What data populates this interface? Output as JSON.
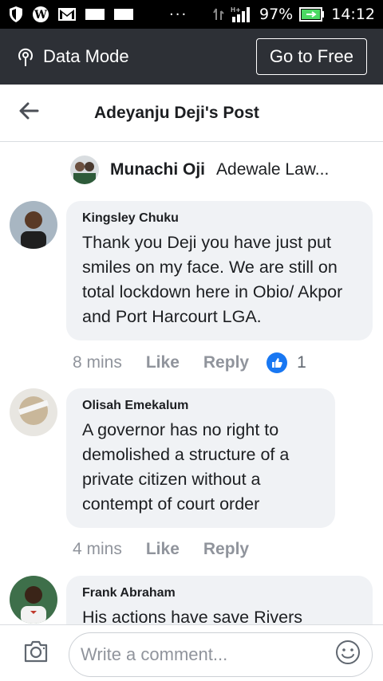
{
  "status_bar": {
    "battery": "97%",
    "time": "14:12",
    "dots": "···",
    "icons": [
      "shield-icon",
      "wordpress-icon",
      "gmail-icon",
      "message-icon",
      "message-icon",
      "vibrate-icon",
      "signal-icon",
      "battery-icon"
    ]
  },
  "data_bar": {
    "label": "Data Mode",
    "button": "Go to Free",
    "icon": "broadcast-icon"
  },
  "header": {
    "title": "Adeyanju Deji's Post",
    "back_icon": "arrow-left-icon"
  },
  "reply_preview": {
    "name": "Munachi Oji",
    "text": "Adewale Law..."
  },
  "comments": [
    {
      "name": "Kingsley Chuku",
      "text": "Thank you Deji you have just put smiles on my face. We are still on total lockdown here in Obio/ Akpor and Port Harcourt LGA.",
      "time": "8 mins",
      "like": "Like",
      "reply": "Reply",
      "reactions": "1"
    },
    {
      "name": "Olisah Emekalum",
      "text": "A governor has no right to demolished a structure of a private citizen without a contempt of court order",
      "time": "4 mins",
      "like": "Like",
      "reply": "Reply"
    },
    {
      "name": "Frank Abraham",
      "text": "His actions have save Rivers"
    }
  ],
  "composer": {
    "placeholder": "Write a comment...",
    "camera_icon": "camera-icon",
    "emoji_icon": "smiley-icon"
  },
  "colors": {
    "accent": "#1877f2",
    "dark_bar": "#2d3036",
    "bubble": "#f0f2f5"
  }
}
